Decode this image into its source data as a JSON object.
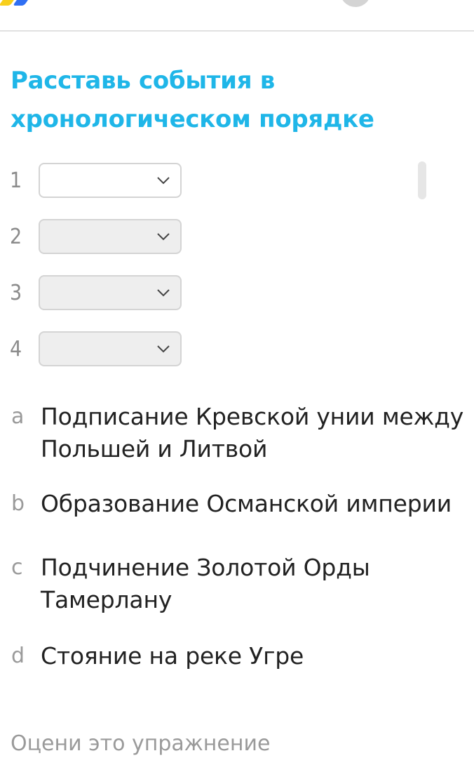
{
  "colors": {
    "title": "#1fb6e8",
    "logo_blue": "#2f6ff3",
    "logo_yellow": "#f8cf1c",
    "avatar": "#d4d4d4"
  },
  "header": {
    "logo_icon": "brand-logo",
    "avatar_icon": "avatar"
  },
  "exercise": {
    "title_line1": "Расставь события в",
    "title_line2": "хронологическом порядке",
    "slots": [
      {
        "number": "1",
        "value": "",
        "state": "active",
        "icon": "chevron-down-icon"
      },
      {
        "number": "2",
        "value": "",
        "state": "disabled",
        "icon": "chevron-down-icon"
      },
      {
        "number": "3",
        "value": "",
        "state": "disabled",
        "icon": "chevron-down-icon"
      },
      {
        "number": "4",
        "value": "",
        "state": "disabled",
        "icon": "chevron-down-icon"
      }
    ],
    "options": [
      {
        "letter": "a",
        "line1": "Подписание Кревской унии между",
        "line2": "Польшей и Литвой"
      },
      {
        "letter": "b",
        "line1": "Образование Османской империи",
        "line2": ""
      },
      {
        "letter": "c",
        "line1": "Подчинение Золотой Орды",
        "line2": "Тамерлану"
      },
      {
        "letter": "d",
        "line1": "Стояние на реке Угре",
        "line2": ""
      }
    ]
  },
  "footer": {
    "rate_label": "Оцени это упражнение"
  }
}
